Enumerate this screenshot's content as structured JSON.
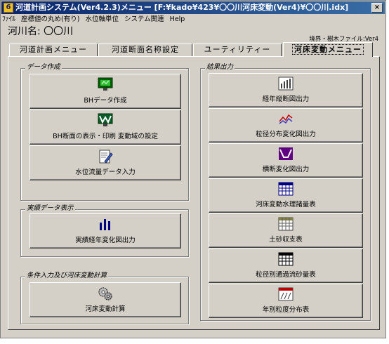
{
  "window": {
    "title": "河道計画システム(Ver4.2.3)メニュー [F:¥kado¥423¥〇〇川河床変動(Ver4)¥〇〇川.idx]",
    "close_label": "×"
  },
  "menubar": [
    "ﾌｧｲﾙ",
    "座標値の丸め(有り)",
    "水位軸単位",
    "システム関連",
    "Help"
  ],
  "header": {
    "river_name": "河川名: 〇〇川",
    "file_info": "境界・樹木ファイル:Ver4"
  },
  "tabs": [
    "河道計画メニュー",
    "河道断面名称設定",
    "ユーティリティー",
    "河床変動メニュー"
  ],
  "active_tab": "河床変動メニュー",
  "groups": {
    "data_creation": {
      "title": "データ作成",
      "buttons": [
        "BHデータ作成",
        "BH断面の表示・印刷 変動域の設定",
        "水位流量データ入力"
      ]
    },
    "actual_display": {
      "title": "実績データ表示",
      "buttons": [
        "実績経年変化図出力"
      ]
    },
    "condition_input": {
      "title": "条件入力及び河床変動計算",
      "buttons": [
        "河床変動計算"
      ]
    },
    "results": {
      "title": "結果出力",
      "buttons": [
        "経年縦断図出力",
        "粒径分布変化図出力",
        "横断変化図出力",
        "河床変動水理諸量表",
        "土砂収支表",
        "粒径別通過流砂量表",
        "年別粒度分布表"
      ]
    }
  },
  "colors": {
    "title_bar": "#0a246a",
    "face": "#d4d0c8"
  }
}
